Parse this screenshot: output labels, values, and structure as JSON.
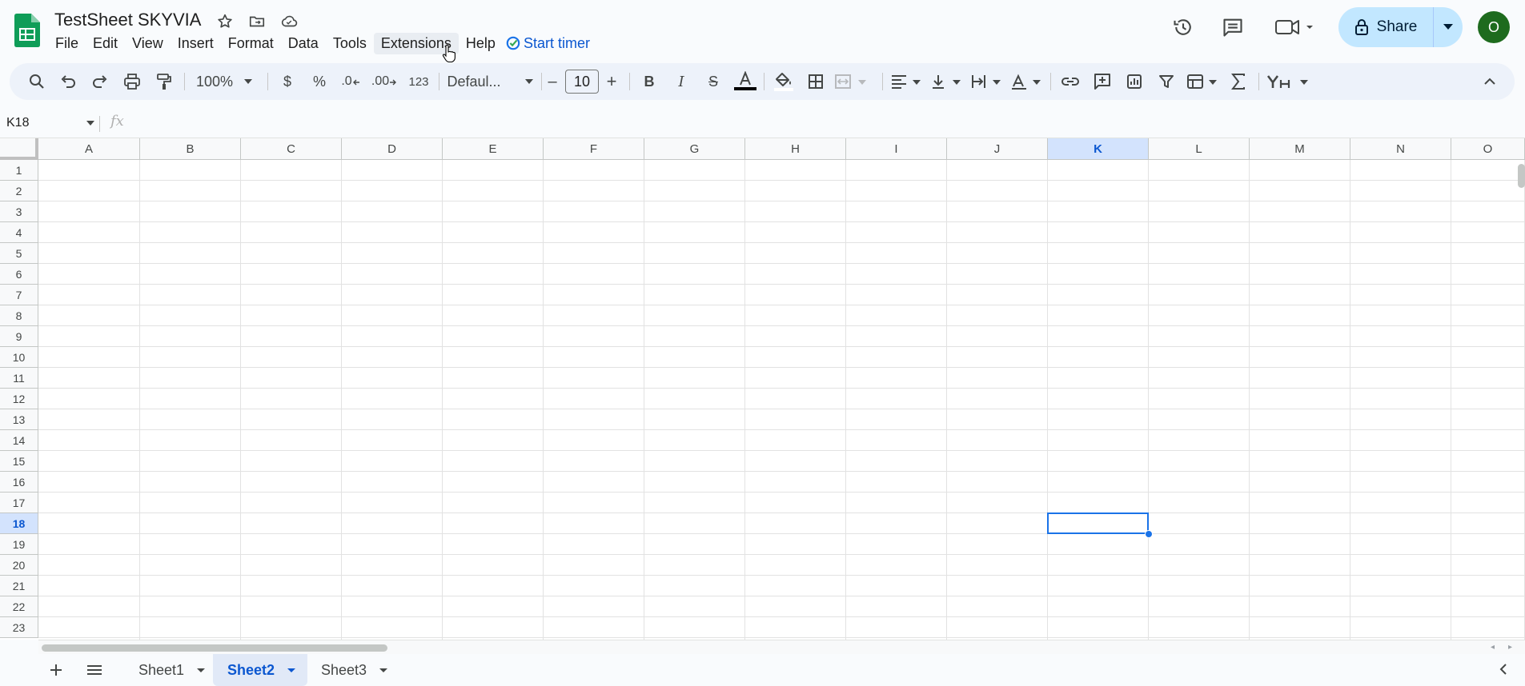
{
  "doc": {
    "title": "TestSheet SKYVIA"
  },
  "menu": [
    "File",
    "Edit",
    "View",
    "Insert",
    "Format",
    "Data",
    "Tools",
    "Extensions",
    "Help"
  ],
  "timer_label": "Start timer",
  "share_label": "Share",
  "avatar_initial": "O",
  "toolbar": {
    "zoom": "100%",
    "currency": "$",
    "percent": "%",
    "dec_decrease": ".0",
    "dec_increase": ".00",
    "more_formats": "123",
    "font": "Defaul...",
    "font_size": "10",
    "minus": "–",
    "plus": "+",
    "bold": "B",
    "italic": "I",
    "strike": "S"
  },
  "formula_bar": {
    "cell_ref": "K18",
    "fx": "fx",
    "value": ""
  },
  "grid": {
    "columns": [
      "A",
      "B",
      "C",
      "D",
      "E",
      "F",
      "G",
      "H",
      "I",
      "J",
      "K",
      "L",
      "M",
      "N",
      "O"
    ],
    "rows": [
      "1",
      "2",
      "3",
      "4",
      "5",
      "6",
      "7",
      "8",
      "9",
      "10",
      "11",
      "12",
      "13",
      "14",
      "15",
      "16",
      "17",
      "18",
      "19",
      "20",
      "21",
      "22",
      "23"
    ],
    "selected_col": "K",
    "selected_row": "18"
  },
  "sheets": [
    {
      "name": "Sheet1",
      "active": false
    },
    {
      "name": "Sheet2",
      "active": true
    },
    {
      "name": "Sheet3",
      "active": false
    }
  ],
  "colors": {
    "accent": "#0b57d0",
    "selection": "#1a73e8",
    "share_bg": "#c2e7ff",
    "logo": "#0f9d58",
    "avatar_bg": "#1e6b1e"
  }
}
